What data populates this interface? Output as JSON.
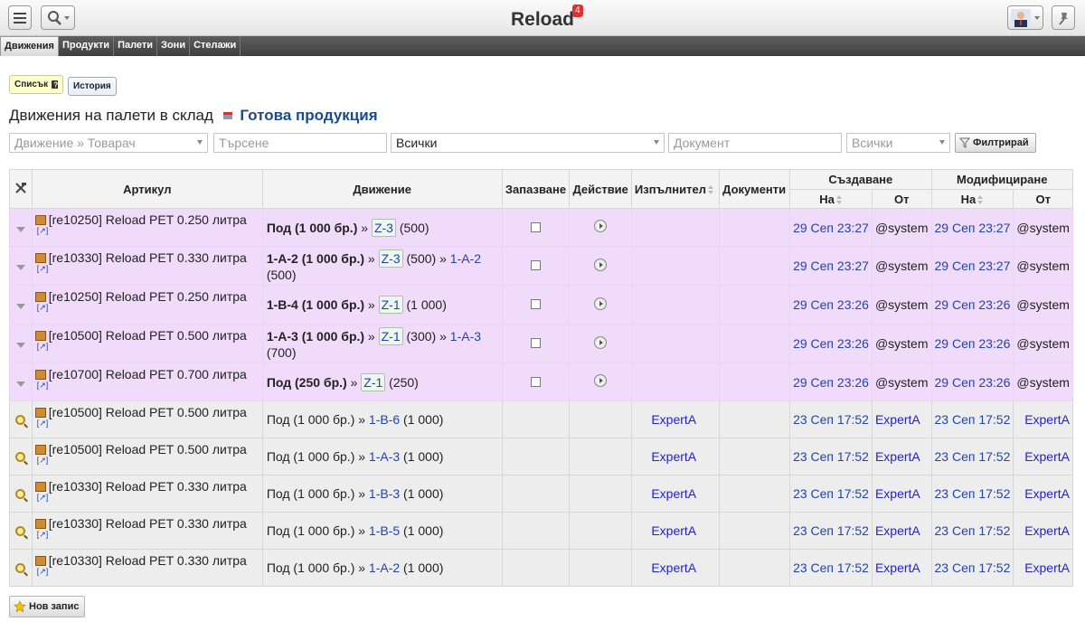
{
  "app": {
    "title": "Reload",
    "notifications": "4"
  },
  "nav": {
    "tabs": [
      {
        "label": "Движения",
        "active": true
      },
      {
        "label": "Продукти",
        "active": false
      },
      {
        "label": "Палети",
        "active": false
      },
      {
        "label": "Зони",
        "active": false
      },
      {
        "label": "Стелажи",
        "active": false
      }
    ]
  },
  "subnav": {
    "list_label": "Списък",
    "history_label": "История"
  },
  "page": {
    "title": "Движения на палети в склад",
    "warehouse": "Готова продукция"
  },
  "filters": {
    "movement": "Движение » Товарач",
    "search_placeholder": "Търсене",
    "status_value": "Всички",
    "document_placeholder": "Документ",
    "all_value": "Всички",
    "filter_button": "Филтрирай"
  },
  "table": {
    "headers": {
      "article": "Артикул",
      "movement": "Движение",
      "reserve": "Запазване",
      "action": "Действие",
      "executor": "Изпълнител",
      "documents": "Документи",
      "created": "Създаване",
      "modified": "Модифициране",
      "on": "На",
      "by": "От"
    },
    "rows": [
      {
        "status": "pending",
        "article": "[re10250] Reload PET 0.250 литра",
        "move_bold": "Под (1 000 бр.)",
        "zone": "Z-3",
        "zone_qty": "(500)",
        "dest": "",
        "dest_qty": "",
        "executor": "",
        "created_on": "29 Сеп 23:27",
        "created_by": "@system",
        "mod_on": "29 Сеп 23:27",
        "mod_by": "@system"
      },
      {
        "status": "pending",
        "article": "[re10330] Reload PET 0.330 литра",
        "move_bold": "1-А-2 (1 000 бр.)",
        "zone": "Z-3",
        "zone_qty": "(500)",
        "dest": "1-А-2",
        "dest_qty": "(500)",
        "executor": "",
        "created_on": "29 Сеп 23:27",
        "created_by": "@system",
        "mod_on": "29 Сеп 23:27",
        "mod_by": "@system"
      },
      {
        "status": "pending",
        "article": "[re10250] Reload PET 0.250 литра",
        "move_bold": "1-В-4 (1 000 бр.)",
        "zone": "Z-1",
        "zone_qty": "(1 000)",
        "dest": "",
        "dest_qty": "",
        "executor": "",
        "created_on": "29 Сеп 23:26",
        "created_by": "@system",
        "mod_on": "29 Сеп 23:26",
        "mod_by": "@system"
      },
      {
        "status": "pending",
        "article": "[re10500] Reload PET 0.500 литра",
        "move_bold": "1-А-3 (1 000 бр.)",
        "zone": "Z-1",
        "zone_qty": "(300)",
        "dest": "1-А-3",
        "dest_qty": "(700)",
        "executor": "",
        "created_on": "29 Сеп 23:26",
        "created_by": "@system",
        "mod_on": "29 Сеп 23:26",
        "mod_by": "@system"
      },
      {
        "status": "pending",
        "article": "[re10700] Reload PET 0.700 литра",
        "move_bold": "Под (250 бр.)",
        "zone": "Z-1",
        "zone_qty": "(250)",
        "dest": "",
        "dest_qty": "",
        "executor": "",
        "created_on": "29 Сеп 23:26",
        "created_by": "@system",
        "mod_on": "29 Сеп 23:26",
        "mod_by": "@system"
      },
      {
        "status": "done",
        "article": "[re10500] Reload PET 0.500 литра",
        "move_plain": "Под (1 000 бр.) »",
        "dest": "1-В-6",
        "dest_qty": "(1 000)",
        "executor": "ExpertA",
        "created_on": "23 Сеп 17:52",
        "created_by": "ExpertA",
        "mod_on": "23 Сеп 17:52",
        "mod_by": "ExpertA"
      },
      {
        "status": "done",
        "article": "[re10500] Reload PET 0.500 литра",
        "move_plain": "Под (1 000 бр.) »",
        "dest": "1-А-3",
        "dest_qty": "(1 000)",
        "executor": "ExpertA",
        "created_on": "23 Сеп 17:52",
        "created_by": "ExpertA",
        "mod_on": "23 Сеп 17:52",
        "mod_by": "ExpertA"
      },
      {
        "status": "done",
        "article": "[re10330] Reload PET 0.330 литра",
        "move_plain": "Под (1 000 бр.) »",
        "dest": "1-В-3",
        "dest_qty": "(1 000)",
        "executor": "ExpertA",
        "created_on": "23 Сеп 17:52",
        "created_by": "ExpertA",
        "mod_on": "23 Сеп 17:52",
        "mod_by": "ExpertA"
      },
      {
        "status": "done",
        "article": "[re10330] Reload PET 0.330 литра",
        "move_plain": "Под (1 000 бр.) »",
        "dest": "1-В-5",
        "dest_qty": "(1 000)",
        "executor": "ExpertA",
        "created_on": "23 Сеп 17:52",
        "created_by": "ExpertA",
        "mod_on": "23 Сеп 17:52",
        "mod_by": "ExpertA"
      },
      {
        "status": "done",
        "article": "[re10330] Reload PET 0.330 литра",
        "move_plain": "Под (1 000 бр.) »",
        "dest": "1-А-2",
        "dest_qty": "(1 000)",
        "executor": "ExpertA",
        "created_on": "23 Сеп 17:52",
        "created_by": "ExpertA",
        "mod_on": "23 Сеп 17:52",
        "mod_by": "ExpertA"
      }
    ]
  },
  "footer": {
    "new_record_label": "Нов запис"
  },
  "colors": {
    "pending_row": "#f0dbfb",
    "done_row": "#ededed",
    "link": "#2244aa",
    "badge": "#e03030"
  },
  "icons": [
    "menu-icon",
    "search-icon",
    "avatar",
    "pin-icon",
    "tools-icon",
    "package-icon",
    "external-link-icon",
    "checkbox",
    "play-icon",
    "magnifier-icon",
    "star-icon",
    "filter-icon",
    "sort-icon",
    "warehouse-icon",
    "help-icon"
  ]
}
